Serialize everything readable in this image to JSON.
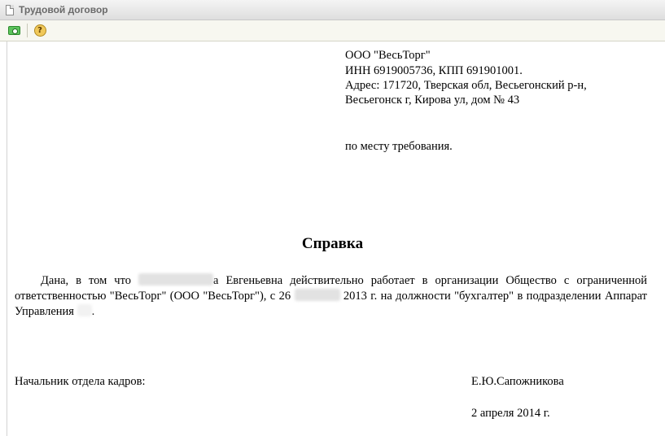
{
  "window": {
    "title": "Трудовой договор"
  },
  "toolbar": {
    "icons": [
      "photo-camera-icon",
      "help-icon"
    ],
    "help_glyph": "?"
  },
  "document": {
    "org_lines": [
      "ООО \"ВесьТорг\"",
      "ИНН 6919005736, КПП 691901001.",
      "Адрес: 171720, Тверская обл, Весьегонский р-н,",
      "Весьегонск г, Кирова ул, дом № 43"
    ],
    "destination": "по месту требования.",
    "heading": "Справка",
    "body": {
      "part1": "Дана, в том что",
      "part2": "а Евгеньевна действительно работает в организации Общество с ограниченной ответственностью \"ВесьТорг\" (ООО \"ВесьТорг\"), с 26",
      "part3": "2013 г. на должности  \"бухгалтер\" в подразделении Аппарат Управления",
      "part4": "."
    },
    "signature": {
      "title": "Начальник отдела кадров:",
      "name": "Е.Ю.Сапожникова",
      "date": "2 апреля 2014 г."
    }
  }
}
